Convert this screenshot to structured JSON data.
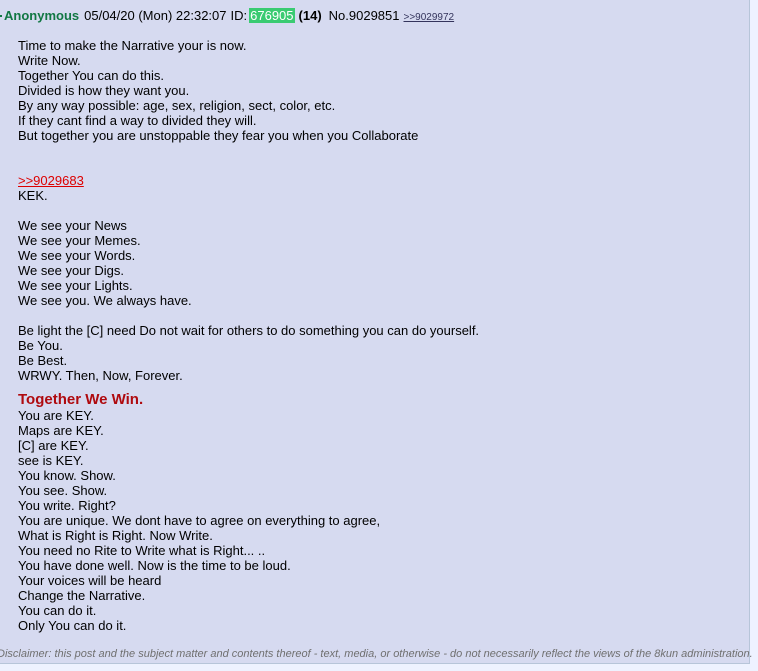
{
  "header": {
    "name": "Anonymous",
    "datetime": "05/04/20 (Mon) 22:32:07",
    "id_label": "ID:",
    "poster_id": "676905",
    "id_count": "(14)",
    "post_no": "No.9029851",
    "backlink": ">>9029972"
  },
  "body": {
    "para1": [
      "Time to make the Narrative your is now.",
      "Write Now.",
      "Together You can do this.",
      "Divided is how they want you.",
      "By any way possible: age, sex, religion, sect, color, etc.",
      "If they cant find a way to divided they will.",
      "But together you are unstoppable they fear you when you Collaborate"
    ],
    "quote_link": ">>9029683",
    "kek": "KEK.",
    "para2": [
      "We see your News",
      "We see your Memes.",
      "We see your Words.",
      "We see your Digs.",
      "We see your Lights.",
      "We see you. We always have."
    ],
    "para3": [
      "Be light the [C] need Do not wait for others to do something you can do yourself.",
      "Be You.",
      "Be Best.",
      "WRWY. Then, Now, Forever."
    ],
    "heading": "Together We Win.",
    "para4": [
      "You are KEY.",
      "Maps are KEY.",
      "[C] are KEY.",
      "see is KEY.",
      "You know. Show.",
      "You see. Show.",
      "You write. Right?",
      "You are unique. We dont have to agree on everything to agree,",
      "What is Right is Right. Now Write.",
      "You need no Rite to Write what is Right... ..",
      "You have done well. Now is the time to be loud.",
      "Your voices will be heard",
      "Change the Narrative.",
      "You can do it.",
      "Only You can do it."
    ]
  },
  "disclaimer": "Disclaimer: this post and the subject matter and contents thereof - text, media, or otherwise - do not necessarily reflect the views of the 8kun administration.",
  "colors": {
    "post_bg": "#d6daf0",
    "page_bg": "#eef2ff",
    "name": "#117743",
    "id_bg": "#3acb72",
    "quote_link": "#dd0000",
    "heading": "#af0a0f"
  }
}
